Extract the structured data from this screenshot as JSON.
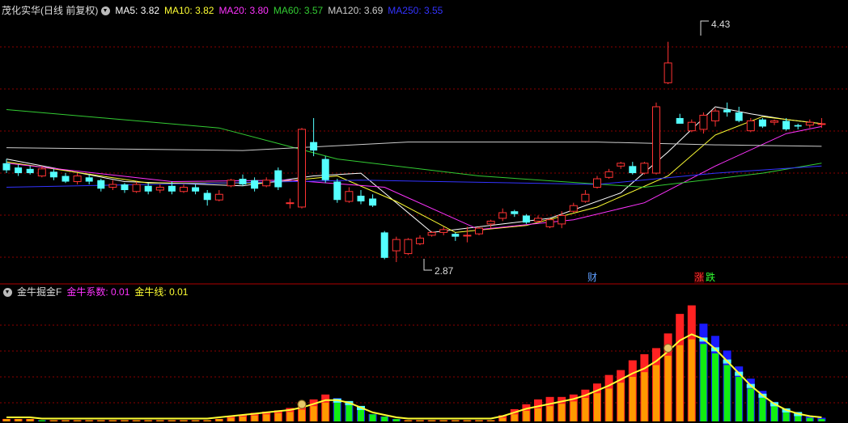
{
  "main_panel": {
    "title": "茂化实华(日线 前复权)",
    "indicators": [
      {
        "label": "MA5",
        "value": "3.82",
        "color": "#ffffff"
      },
      {
        "label": "MA10",
        "value": "3.82",
        "color": "#ffff33"
      },
      {
        "label": "MA20",
        "value": "3.80",
        "color": "#ff33ff"
      },
      {
        "label": "MA60",
        "value": "3.57",
        "color": "#33cc33"
      },
      {
        "label": "MA120",
        "value": "3.69",
        "color": "#cccccc"
      },
      {
        "label": "MA250",
        "value": "3.55",
        "color": "#3333ff"
      }
    ],
    "high_label": "4.43",
    "low_label": "2.87",
    "markers": {
      "cai": "财",
      "zhang": "涨",
      "die": "跌"
    }
  },
  "sub_panel": {
    "title": "金牛掘金F",
    "indicators": [
      {
        "label": "金牛系数",
        "value": "0.01",
        "color": "#ff33ff"
      },
      {
        "label": "金牛线",
        "value": "0.01",
        "color": "#ffff33"
      }
    ]
  },
  "colors": {
    "up": "#ff3333",
    "down": "#54ffff",
    "grid": "#8b0000",
    "border": "#b00000"
  },
  "chart_data": {
    "type": "candlestick",
    "price_ylim": [
      2.75,
      4.6
    ],
    "candles": [
      [
        3.57,
        3.52,
        3.6,
        3.5
      ],
      [
        3.54,
        3.5,
        3.56,
        3.48
      ],
      [
        3.53,
        3.5,
        3.55,
        3.49
      ],
      [
        3.48,
        3.53,
        3.55,
        3.47
      ],
      [
        3.51,
        3.47,
        3.53,
        3.45
      ],
      [
        3.48,
        3.44,
        3.5,
        3.43
      ],
      [
        3.44,
        3.48,
        3.5,
        3.42
      ],
      [
        3.47,
        3.44,
        3.49,
        3.42
      ],
      [
        3.45,
        3.39,
        3.46,
        3.37
      ],
      [
        3.4,
        3.42,
        3.45,
        3.38
      ],
      [
        3.42,
        3.38,
        3.43,
        3.36
      ],
      [
        3.37,
        3.42,
        3.44,
        3.36
      ],
      [
        3.41,
        3.37,
        3.43,
        3.35
      ],
      [
        3.38,
        3.4,
        3.42,
        3.36
      ],
      [
        3.41,
        3.37,
        3.44,
        3.35
      ],
      [
        3.37,
        3.4,
        3.42,
        3.36
      ],
      [
        3.4,
        3.37,
        3.42,
        3.35
      ],
      [
        3.36,
        3.31,
        3.38,
        3.27
      ],
      [
        3.31,
        3.35,
        3.38,
        3.3
      ],
      [
        3.41,
        3.45,
        3.46,
        3.4
      ],
      [
        3.46,
        3.42,
        3.49,
        3.41
      ],
      [
        3.45,
        3.39,
        3.47,
        3.37
      ],
      [
        3.41,
        3.45,
        3.47,
        3.4
      ],
      [
        3.52,
        3.4,
        3.54,
        3.38
      ],
      [
        3.29,
        3.29,
        3.32,
        3.25
      ],
      [
        3.26,
        3.81,
        3.82,
        3.25
      ],
      [
        3.72,
        3.66,
        3.89,
        3.62
      ],
      [
        3.6,
        3.45,
        3.62,
        3.43
      ],
      [
        3.44,
        3.31,
        3.46,
        3.29
      ],
      [
        3.3,
        3.37,
        3.4,
        3.29
      ],
      [
        3.34,
        3.3,
        3.38,
        3.28
      ],
      [
        3.32,
        3.27,
        3.35,
        3.26
      ],
      [
        3.08,
        2.9,
        3.09,
        2.89
      ],
      [
        2.95,
        3.03,
        3.05,
        2.87
      ],
      [
        2.93,
        3.03,
        3.04,
        2.92
      ],
      [
        3.0,
        3.04,
        3.06,
        2.99
      ],
      [
        3.06,
        3.08,
        3.09,
        3.05
      ],
      [
        3.08,
        3.1,
        3.12,
        3.06
      ],
      [
        3.07,
        3.05,
        3.08,
        3.02
      ],
      [
        3.06,
        3.06,
        3.12,
        3.01
      ],
      [
        3.07,
        3.11,
        3.12,
        3.06
      ],
      [
        3.14,
        3.16,
        3.17,
        3.11
      ],
      [
        3.18,
        3.22,
        3.25,
        3.16
      ],
      [
        3.23,
        3.21,
        3.24,
        3.19
      ],
      [
        3.2,
        3.15,
        3.21,
        3.14
      ],
      [
        3.16,
        3.18,
        3.2,
        3.15
      ],
      [
        3.12,
        3.17,
        3.18,
        3.11
      ],
      [
        3.14,
        3.2,
        3.23,
        3.11
      ],
      [
        3.23,
        3.27,
        3.29,
        3.22
      ],
      [
        3.3,
        3.35,
        3.38,
        3.29
      ],
      [
        3.4,
        3.46,
        3.48,
        3.39
      ],
      [
        3.47,
        3.51,
        3.53,
        3.46
      ],
      [
        3.55,
        3.57,
        3.58,
        3.53
      ],
      [
        3.55,
        3.5,
        3.58,
        3.49
      ],
      [
        3.5,
        3.57,
        3.58,
        3.49
      ],
      [
        3.5,
        3.97,
        4.0,
        3.49
      ],
      [
        4.14,
        4.28,
        4.43,
        4.13
      ],
      [
        3.89,
        3.85,
        3.92,
        3.85
      ],
      [
        3.8,
        3.86,
        3.88,
        3.79
      ],
      [
        3.81,
        3.91,
        3.93,
        3.78
      ],
      [
        3.87,
        3.94,
        3.96,
        3.83
      ],
      [
        3.95,
        3.93,
        4.0,
        3.9
      ],
      [
        3.93,
        3.87,
        3.97,
        3.86
      ],
      [
        3.8,
        3.87,
        3.89,
        3.79
      ],
      [
        3.88,
        3.83,
        3.89,
        3.82
      ],
      [
        3.86,
        3.87,
        3.88,
        3.84
      ],
      [
        3.87,
        3.81,
        3.89,
        3.8
      ],
      [
        3.84,
        3.83,
        3.85,
        3.81
      ],
      [
        3.84,
        3.86,
        3.88,
        3.82
      ],
      [
        3.85,
        3.85,
        3.89,
        3.82
      ]
    ],
    "ma_lines": {
      "MA5": [
        [
          0,
          3.6
        ],
        [
          10,
          3.44
        ],
        [
          20,
          3.41
        ],
        [
          26,
          3.48
        ],
        [
          30,
          3.5
        ],
        [
          32,
          3.36
        ],
        [
          36,
          3.08
        ],
        [
          42,
          3.14
        ],
        [
          46,
          3.18
        ],
        [
          52,
          3.36
        ],
        [
          56,
          3.65
        ],
        [
          60,
          3.97
        ],
        [
          63,
          3.92
        ],
        [
          66,
          3.88
        ],
        [
          69,
          3.85
        ]
      ],
      "MA10": [
        [
          0,
          3.58
        ],
        [
          12,
          3.43
        ],
        [
          22,
          3.43
        ],
        [
          28,
          3.48
        ],
        [
          33,
          3.3
        ],
        [
          38,
          3.08
        ],
        [
          44,
          3.13
        ],
        [
          50,
          3.26
        ],
        [
          56,
          3.48
        ],
        [
          60,
          3.77
        ],
        [
          64,
          3.9
        ],
        [
          69,
          3.85
        ]
      ],
      "MA20": [
        [
          0,
          3.57
        ],
        [
          14,
          3.44
        ],
        [
          24,
          3.45
        ],
        [
          32,
          3.4
        ],
        [
          40,
          3.1
        ],
        [
          48,
          3.17
        ],
        [
          54,
          3.29
        ],
        [
          60,
          3.55
        ],
        [
          66,
          3.78
        ],
        [
          69,
          3.83
        ]
      ],
      "MA60": [
        [
          0,
          3.95
        ],
        [
          18,
          3.82
        ],
        [
          28,
          3.6
        ],
        [
          40,
          3.48
        ],
        [
          54,
          3.4
        ],
        [
          64,
          3.5
        ],
        [
          69,
          3.57
        ]
      ],
      "MA120": [
        [
          0,
          3.68
        ],
        [
          20,
          3.66
        ],
        [
          34,
          3.72
        ],
        [
          50,
          3.72
        ],
        [
          60,
          3.7
        ],
        [
          69,
          3.69
        ]
      ],
      "MA250": [
        [
          0,
          3.4
        ],
        [
          30,
          3.45
        ],
        [
          50,
          3.42
        ],
        [
          60,
          3.5
        ],
        [
          69,
          3.55
        ]
      ]
    },
    "sub_ylim": [
      0,
      1
    ],
    "sub_bars": {
      "coefficient": [
        0.02,
        0.02,
        0.02,
        0.01,
        0.01,
        0.01,
        0.01,
        0.01,
        0.01,
        0.01,
        0.01,
        0.01,
        0.01,
        0.01,
        0.01,
        0.01,
        0.01,
        0.01,
        0.02,
        0.04,
        0.05,
        0.07,
        0.08,
        0.09,
        0.11,
        0.15,
        0.18,
        0.22,
        0.19,
        0.14,
        0.09,
        0.05,
        0.03,
        0.01,
        0.01,
        0.01,
        0.01,
        0.01,
        0.01,
        0.01,
        0.01,
        0.01,
        0.05,
        0.1,
        0.14,
        0.18,
        0.2,
        0.2,
        0.22,
        0.26,
        0.31,
        0.38,
        0.42,
        0.5,
        0.55,
        0.6,
        0.72,
        0.88,
        0.95,
        0.8,
        0.7,
        0.58,
        0.45,
        0.35,
        0.25,
        0.16,
        0.1,
        0.06,
        0.04,
        0.03
      ],
      "line": [
        0.02,
        0.02,
        0.02,
        0.01,
        0.01,
        0.01,
        0.01,
        0.01,
        0.01,
        0.01,
        0.01,
        0.01,
        0.01,
        0.01,
        0.01,
        0.01,
        0.01,
        0.01,
        0.02,
        0.03,
        0.04,
        0.05,
        0.06,
        0.07,
        0.08,
        0.1,
        0.13,
        0.16,
        0.16,
        0.14,
        0.1,
        0.06,
        0.04,
        0.02,
        0.01,
        0.01,
        0.01,
        0.01,
        0.01,
        0.01,
        0.01,
        0.01,
        0.03,
        0.06,
        0.09,
        0.11,
        0.13,
        0.15,
        0.17,
        0.2,
        0.24,
        0.28,
        0.33,
        0.38,
        0.42,
        0.48,
        0.56,
        0.65,
        0.7,
        0.66,
        0.58,
        0.48,
        0.38,
        0.28,
        0.2,
        0.13,
        0.08,
        0.05,
        0.03,
        0.02
      ]
    }
  }
}
